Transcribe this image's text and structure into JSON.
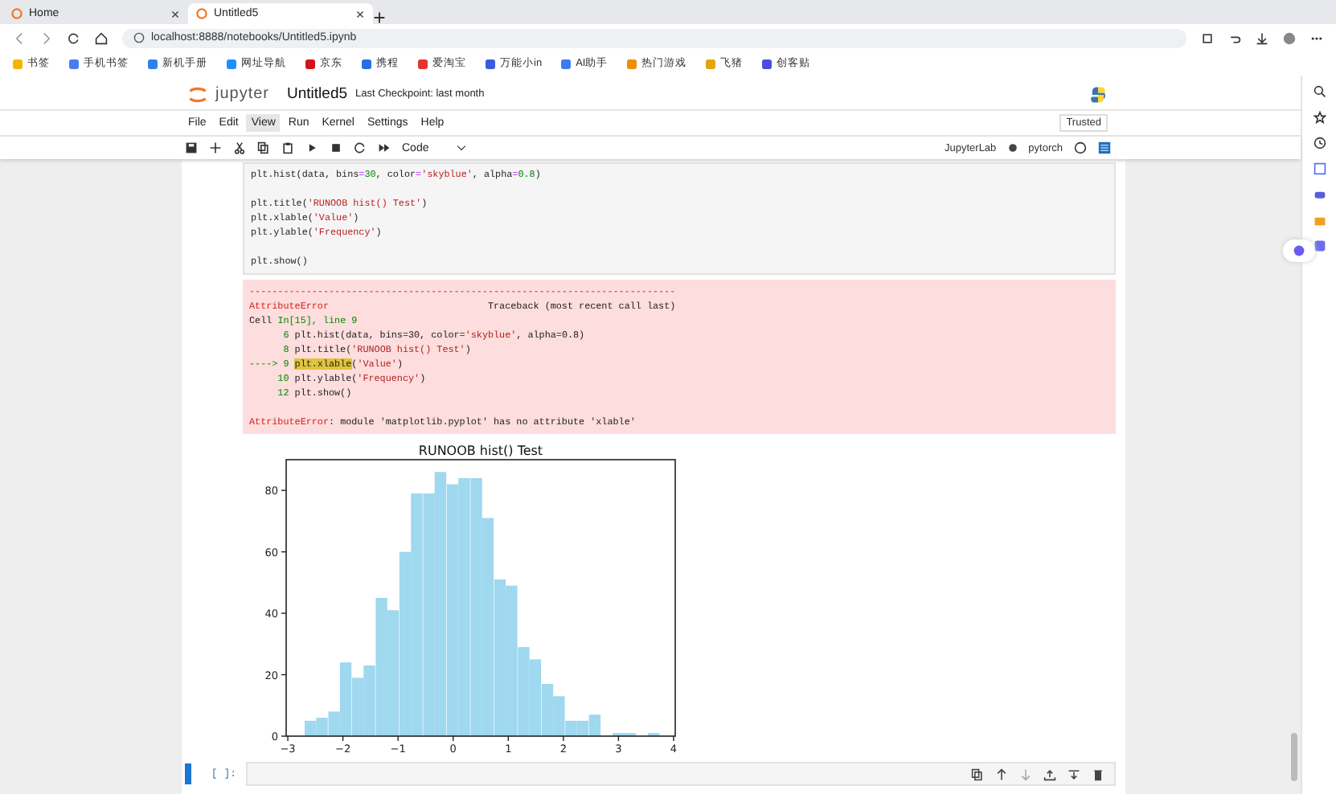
{
  "browser": {
    "tabs": [
      {
        "title": "Home",
        "selected": false
      },
      {
        "title": "Untitled5",
        "selected": true
      }
    ],
    "address": "localhost:8888/notebooks/Untitled5.ipynb",
    "bookmarks": [
      {
        "label": "书签",
        "color": "#f5b400"
      },
      {
        "label": "手机书签",
        "color": "#4a7cf0"
      },
      {
        "label": "新机手册",
        "color": "#2f80ed"
      },
      {
        "label": "网址导航",
        "color": "#1e90ff"
      },
      {
        "label": "京东",
        "color": "#d1131b"
      },
      {
        "label": "携程",
        "color": "#2a6fe0"
      },
      {
        "label": "爱淘宝",
        "color": "#e8322f"
      },
      {
        "label": "万能小in",
        "color": "#3b5bdb"
      },
      {
        "label": "AI助手",
        "color": "#3d7bf5"
      },
      {
        "label": "热门游戏",
        "color": "#f08c00"
      },
      {
        "label": "飞猪",
        "color": "#e0a800"
      },
      {
        "label": "创客贴",
        "color": "#4c4ce0"
      }
    ]
  },
  "notebook": {
    "logo_text": "jupyter",
    "title": "Untitled5",
    "checkpoint": "Last Checkpoint: last month",
    "menu": [
      {
        "label": "File",
        "selected": false
      },
      {
        "label": "Edit",
        "selected": false
      },
      {
        "label": "View",
        "selected": true
      },
      {
        "label": "Run",
        "selected": false
      },
      {
        "label": "Kernel",
        "selected": false
      },
      {
        "label": "Settings",
        "selected": false
      },
      {
        "label": "Help",
        "selected": false
      }
    ],
    "trusted": "Trusted",
    "cell_type": "Code",
    "jupyterlab_link": "JupyterLab",
    "kernel": "pytorch"
  },
  "code_cell": {
    "lines": [
      {
        "text": "plt.hist(data, bins=30, color='skyblue', alpha=0.8)",
        "gap_before": false
      },
      {
        "text": "plt.title('RUNOOB hist() Test')",
        "gap_before": true
      },
      {
        "text": "plt.xlable('Value')",
        "gap_before": false
      },
      {
        "text": "plt.ylable('Frequency')",
        "gap_before": false
      },
      {
        "text": "plt.show()",
        "gap_before": true
      }
    ]
  },
  "error_output": {
    "lines": [
      {
        "gap_before": false,
        "segments": [
          {
            "text": "---------------------------------------------------------------------------",
            "kind": "error"
          }
        ]
      },
      {
        "gap_before": false,
        "segments": [
          {
            "text": "AttributeError",
            "kind": "error"
          },
          {
            "text": "                            Traceback (most recent call last)",
            "kind": "plain"
          }
        ]
      },
      {
        "gap_before": false,
        "segments": [
          {
            "text": "Cell ",
            "kind": "plain"
          },
          {
            "text": "In[15], line 9",
            "kind": "green"
          }
        ]
      },
      {
        "gap_before": false,
        "segments": [
          {
            "text": "      6 ",
            "kind": "green"
          },
          {
            "text": "plt.hist(data, bins=30, color=",
            "kind": "plain"
          },
          {
            "text": "'skyblue'",
            "kind": "str"
          },
          {
            "text": ", alpha=0.8)",
            "kind": "plain"
          }
        ]
      },
      {
        "gap_before": false,
        "segments": [
          {
            "text": "      8 ",
            "kind": "green"
          },
          {
            "text": "plt.title(",
            "kind": "plain"
          },
          {
            "text": "'RUNOOB hist() Test'",
            "kind": "str"
          },
          {
            "text": ")",
            "kind": "plain"
          }
        ]
      },
      {
        "gap_before": false,
        "segments": [
          {
            "text": "----> 9 ",
            "kind": "green"
          },
          {
            "text": "plt.xlable",
            "kind": "highlight"
          },
          {
            "text": "(",
            "kind": "plain"
          },
          {
            "text": "'Value'",
            "kind": "str"
          },
          {
            "text": ")",
            "kind": "plain"
          }
        ]
      },
      {
        "gap_before": false,
        "segments": [
          {
            "text": "     10 ",
            "kind": "green"
          },
          {
            "text": "plt.ylable(",
            "kind": "plain"
          },
          {
            "text": "'Frequency'",
            "kind": "str"
          },
          {
            "text": ")",
            "kind": "plain"
          }
        ]
      },
      {
        "gap_before": false,
        "segments": [
          {
            "text": "     12 ",
            "kind": "green"
          },
          {
            "text": "plt.show()",
            "kind": "plain"
          }
        ]
      },
      {
        "gap_before": true,
        "segments": [
          {
            "text": "AttributeError",
            "kind": "error"
          },
          {
            "text": ": module 'matplotlib.pyplot' has no attribute 'xlable'",
            "kind": "plain"
          }
        ]
      }
    ]
  },
  "plot_output": {
    "chart_data": {
      "type": "bar",
      "title": "RUNOOB hist() Test",
      "x": [
        -2.59,
        -2.38,
        -2.16,
        -1.95,
        -1.73,
        -1.52,
        -1.3,
        -1.09,
        -0.87,
        -0.66,
        -0.44,
        -0.23,
        -0.01,
        0.2,
        0.42,
        0.63,
        0.85,
        1.06,
        1.28,
        1.49,
        1.71,
        1.92,
        2.14,
        2.35,
        2.57,
        2.78,
        3.0,
        3.21,
        3.43,
        3.64
      ],
      "series": [
        {
          "color": "#87ceeb",
          "values": [
            5,
            6,
            8,
            24,
            19,
            23,
            45,
            41,
            60,
            79,
            79,
            86,
            82,
            84,
            84,
            71,
            51,
            49,
            29,
            25,
            17,
            13,
            5,
            5,
            7,
            0,
            1,
            1,
            0,
            1
          ]
        }
      ],
      "xlim": [
        -3.03,
        4.03
      ],
      "ylim": [
        0,
        90
      ],
      "xticks": [
        {
          "value": -3,
          "label": "−3"
        },
        {
          "value": -2,
          "label": "−2"
        },
        {
          "value": -1,
          "label": "−1"
        },
        0,
        1,
        2,
        3,
        4
      ],
      "yticks": [
        0,
        20,
        40,
        60,
        80
      ]
    }
  },
  "empty_cell": {
    "prompt": "[ ]:"
  }
}
